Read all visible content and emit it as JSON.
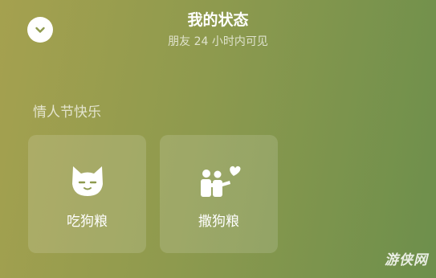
{
  "header": {
    "title": "我的状态",
    "subtitle": "朋友 24 小时内可见",
    "collapse_icon": "chevron-down-icon"
  },
  "section": {
    "label": "情人节快乐"
  },
  "cards": [
    {
      "label": "吃狗粮",
      "icon": "cat-face-icon"
    },
    {
      "label": "撒狗粮",
      "icon": "couple-heart-icon"
    }
  ],
  "watermark": {
    "text": "游侠网"
  },
  "colors": {
    "background_left": "#a5a14f",
    "background_right": "#6d8f4c",
    "text": "#ffffff",
    "chevron": "#8e9a4e"
  }
}
